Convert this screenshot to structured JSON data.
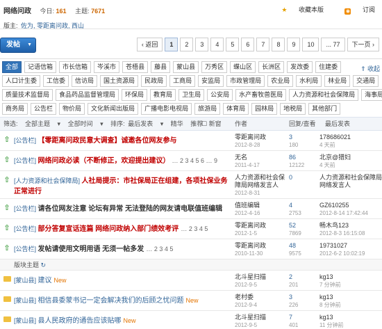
{
  "header": {
    "title": "网络问政",
    "today_label": "今日:",
    "today_value": "161",
    "topics_label": "主题:",
    "topics_value": "7671",
    "moderators_label": "版主:",
    "moderators": "佐为, 零距离问政, 西山",
    "favorite_label": "收藏本版",
    "rss_label": "订阅"
  },
  "post_button": {
    "label": "发帖"
  },
  "pager": [
    "‹ 返回",
    "1",
    "2",
    "3",
    "4",
    "5",
    "6",
    "7",
    "8",
    "9",
    "10",
    "... 77",
    "下一页 ›"
  ],
  "pager_current": "1",
  "tags": {
    "collapse_label": "收起",
    "rows": [
      [
        "全部",
        "记语信箱",
        "市长信箱",
        "岑溪市",
        "苍梧县",
        "藤县",
        "蒙山县",
        "万秀区",
        "蝶山区",
        "长洲区",
        "发改委",
        "住建委"
      ],
      [
        "人口计生委",
        "工信委",
        "信访局",
        "国土资源局",
        "民政局",
        "工商局",
        "安监局",
        "市政管理局",
        "农业局",
        "水利局",
        "林业局",
        "交通局"
      ],
      [
        "质量技术监督局",
        "食品药品监督管理局",
        "环保局",
        "教育局",
        "卫生局",
        "公安局",
        "水产畜牧兽医局",
        "人力资源和社会保障局",
        "海事局"
      ],
      [
        "商务局",
        "公告栏",
        "物价局",
        "文化新闻出版局",
        "广播电影电视局",
        "旅游局",
        "体育局",
        "园林局",
        "地税局",
        "其他部门"
      ]
    ]
  },
  "filter": {
    "filter_label": "筛选:",
    "all_topics": "全部主题",
    "all_time": "全部时间",
    "sort_label": "排序:",
    "sort_value": "最后发表",
    "digest": "精华",
    "recommend": "推荐",
    "new_window": "新窗",
    "col_author": "作者",
    "col_reply": "回复/查看",
    "col_last": "最后发表"
  },
  "threads": [
    {
      "cat": "[公告栏]",
      "title": "【零距离问政民意大调查】诚邀各位网友参与",
      "color": "#c00000",
      "pages": "",
      "author": "零距离问政",
      "date": "2012-8-28",
      "replies": "3",
      "views": "180",
      "last_user": "178686021",
      "last_time": "4 天前"
    },
    {
      "cat": "[公告栏]",
      "title": "网络问政必读（不断修正，欢迎提出建议）",
      "color": "#c00000",
      "pages": "… 2 3 4 5 6 … 9",
      "author": "无名",
      "date": "2011-4-17",
      "replies": "86",
      "views": "12122",
      "last_user": "北京@猎妇",
      "last_time": "4 天前"
    },
    {
      "cat": "[人力资源和社会保障局]",
      "title": "人社局提示：市社保局正在组建，各项社保业务正常进行",
      "color": "#c00000",
      "pages": "",
      "author": "人力资源和社会保障局网络发言人",
      "date": "2012-8-31",
      "replies": "0",
      "views": "",
      "last_user": "人力资源和社会保障局网络发言人",
      "last_time": ""
    },
    {
      "cat": "[公告栏]",
      "title": "请各位网友注意 论坛有异常 无法登陆的网友请电联值班编辑",
      "color": "#333333",
      "pages": "",
      "author": "值班编辑",
      "date": "2012-4-16",
      "replies": "4",
      "views": "2753",
      "last_user": "GZ610255",
      "last_time": "2012-8-14 17:42:44"
    },
    {
      "cat": "[公告栏]",
      "title": "部分答复宣话连篇 网络问政纳入部门绩效考评",
      "color": "#c00000",
      "pages": "… 2 3 4 5",
      "author": "零距离问政",
      "date": "2012-1-5",
      "replies": "52",
      "views": "7869",
      "last_user": "畅木鸟123",
      "last_time": "2012-8-3 16:15:08"
    },
    {
      "cat": "[公告栏]",
      "title": "发帖请使用文明用语 无须一帖多发",
      "color": "#333333",
      "pages": "… 2 3 4 5",
      "author": "零距离问政",
      "date": "2010-11-30",
      "replies": "48",
      "views": "9575",
      "last_user": "19731027",
      "last_time": "2012-6-2 10:02:19"
    }
  ],
  "section_label": "版块主题",
  "board_threads": [
    {
      "cat": "[蒙山县]",
      "title": "建议",
      "new": "New",
      "author": "北斗星扫描",
      "date": "2012-9-5",
      "replies": "2",
      "views": "201",
      "last_user": "kg13",
      "last_time": "7 分钟前"
    },
    {
      "cat": "[蒙山县]",
      "title": "相信县委蒙书记一定会解决我们的后顾之忧问题",
      "new": "New",
      "author": "老村委",
      "date": "2012-9-4",
      "replies": "3",
      "views": "226",
      "last_user": "kg13",
      "last_time": "8 分钟前"
    },
    {
      "cat": "[蒙山县]",
      "title": "县人民政府的通告应该贴哪",
      "new": "New",
      "author": "北斗星扫描",
      "date": "2012-9-5",
      "replies": "7",
      "views": "401",
      "last_user": "kg13",
      "last_time": "11 分钟前"
    }
  ]
}
